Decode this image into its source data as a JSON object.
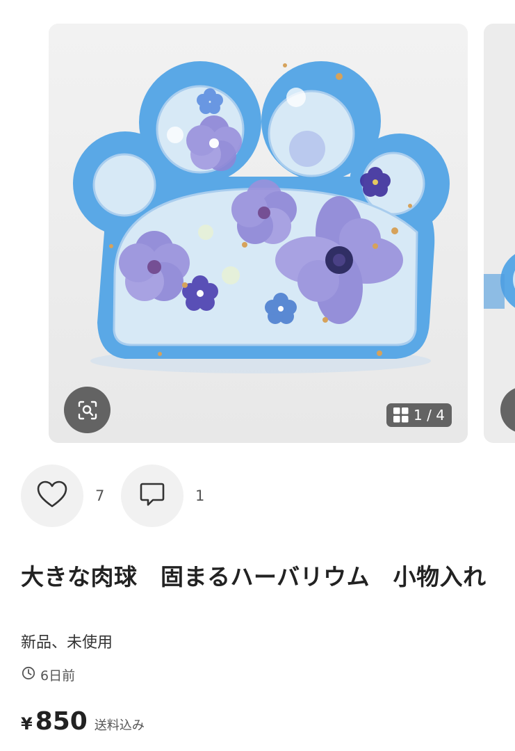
{
  "gallery": {
    "counter_text": "1 / 4",
    "zoom_icon": "zoom-scan-icon",
    "grid_icon": "grid-icon"
  },
  "actions": {
    "like": {
      "icon": "heart-icon",
      "count": "7"
    },
    "comment": {
      "icon": "comment-icon",
      "count": "1"
    }
  },
  "item": {
    "title": "大きな肉球　固まるハーバリウム　小物入れ",
    "condition": "新品、未使用",
    "posted": "6日前",
    "posted_icon": "clock-icon"
  },
  "price": {
    "currency": "¥",
    "amount": "850",
    "shipping": "送料込み"
  },
  "colors": {
    "resin_blue": "#5aa8e6",
    "pad_fill": "#d5e8f6",
    "flower_purple": "#8e86d6",
    "overlay": "#464646"
  }
}
